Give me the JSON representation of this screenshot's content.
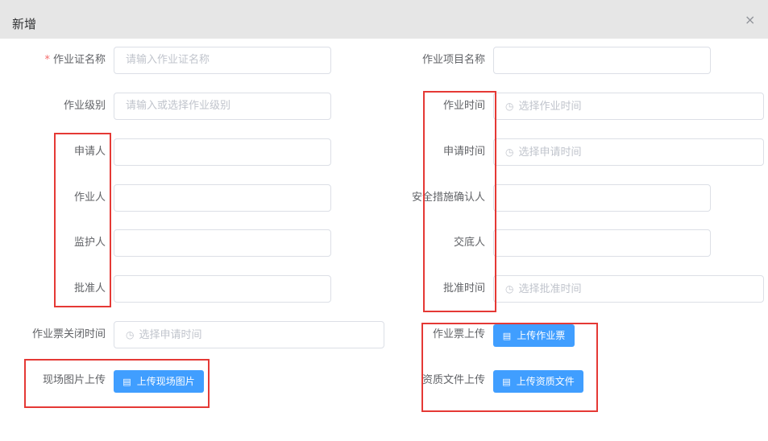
{
  "dialog": {
    "title": "新增",
    "close_icon": "close-icon",
    "close_glyph": "×"
  },
  "left_fields": [
    {
      "label": "作业证名称",
      "required": "*",
      "placeholder": "请输入作业证名称"
    },
    {
      "label": "作业级别",
      "placeholder": "请输入或选择作业级别"
    },
    {
      "label": "申请人",
      "placeholder": ""
    },
    {
      "label": "作业人",
      "placeholder": ""
    },
    {
      "label": "监护人",
      "placeholder": ""
    },
    {
      "label": "批准人",
      "placeholder": ""
    },
    {
      "label": "作业票关闭时间",
      "placeholder": "选择申请时间",
      "icon": "clock-icon"
    }
  ],
  "right_fields": [
    {
      "label": "作业项目名称",
      "placeholder": ""
    },
    {
      "label": "作业时间",
      "placeholder": "选择作业时间",
      "icon": "clock-icon"
    },
    {
      "label": "申请时间",
      "placeholder": "选择申请时间",
      "icon": "clock-icon"
    },
    {
      "label": "安全措施确认人",
      "placeholder": ""
    },
    {
      "label": "交底人",
      "placeholder": ""
    },
    {
      "label": "批准时间",
      "placeholder": "选择批准时间",
      "icon": "clock-icon"
    }
  ],
  "uploads": {
    "site_photo": {
      "label": "现场图片上传",
      "button": "上传现场图片",
      "icon": "file-icon"
    },
    "ticket": {
      "label": "作业票上传",
      "button": "上传作业票",
      "icon": "file-icon"
    },
    "qualification": {
      "label": "资质文件上传",
      "button": "上传资质文件",
      "icon": "file-icon"
    }
  },
  "icons": {
    "clock": "◷",
    "file": "▤"
  },
  "colors": {
    "primary": "#409eff",
    "highlight": "#e53935",
    "required": "#f56c6c"
  }
}
